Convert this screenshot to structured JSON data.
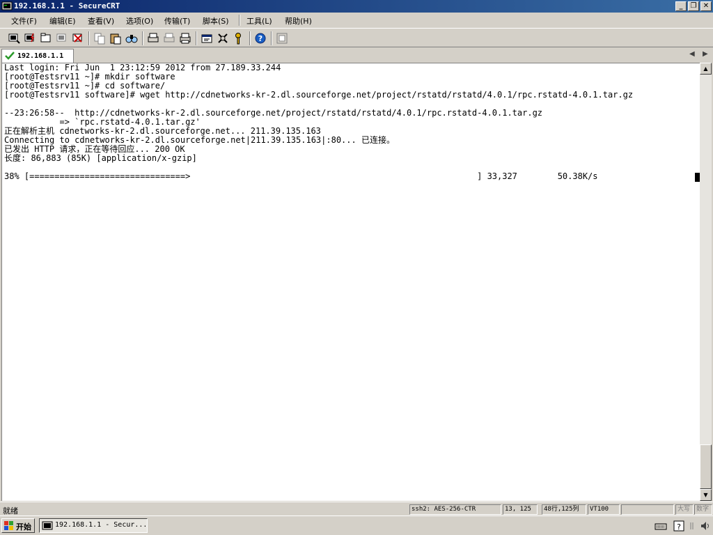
{
  "window": {
    "title": "192.168.1.1 - SecureCRT",
    "buttons": {
      "minimize": "_",
      "maximize": "❐",
      "close": "✕"
    }
  },
  "menu": [
    {
      "label": "文件(F)"
    },
    {
      "label": "编辑(E)"
    },
    {
      "label": "查看(V)"
    },
    {
      "label": "选项(O)"
    },
    {
      "label": "传输(T)"
    },
    {
      "label": "脚本(S)"
    },
    {
      "label": "工具(L)"
    },
    {
      "label": "帮助(H)"
    }
  ],
  "tabs": [
    {
      "label": "192.168.1.1",
      "active": true
    }
  ],
  "terminal": {
    "lines": [
      "Last login: Fri Jun  1 23:12:59 2012 from 27.189.33.244",
      "[root@Testsrv11 ~]# mkdir software",
      "[root@Testsrv11 ~]# cd software/",
      "[root@Testsrv11 software]# wget http://cdnetworks-kr-2.dl.sourceforge.net/project/rstatd/rstatd/4.0.1/rpc.rstatd-4.0.1.tar.gz",
      "",
      "--23:26:58--  http://cdnetworks-kr-2.dl.sourceforge.net/project/rstatd/rstatd/4.0.1/rpc.rstatd-4.0.1.tar.gz",
      "           => `rpc.rstatd-4.0.1.tar.gz'",
      "正在解析主机 cdnetworks-kr-2.dl.sourceforge.net... 211.39.135.163",
      "Connecting to cdnetworks-kr-2.dl.sourceforge.net|211.39.135.163|:80... 已连接。",
      "已发出 HTTP 请求，正在等待回应... 200 OK",
      "长度: 86,883 (85K) [application/x-gzip]",
      "",
      "38% [===============================>                                                         ] 33,327        50.38K/s"
    ]
  },
  "status": {
    "text": "就绪",
    "cipher": "ssh2: AES-256-CTR",
    "position": "13, 125",
    "size": "48行,125列",
    "emulation": "VT100",
    "blank": "",
    "caps": "大写",
    "num": "数字"
  },
  "taskbar": {
    "start_label": "开始",
    "task_label": "192.168.1.1 - Secur..."
  }
}
